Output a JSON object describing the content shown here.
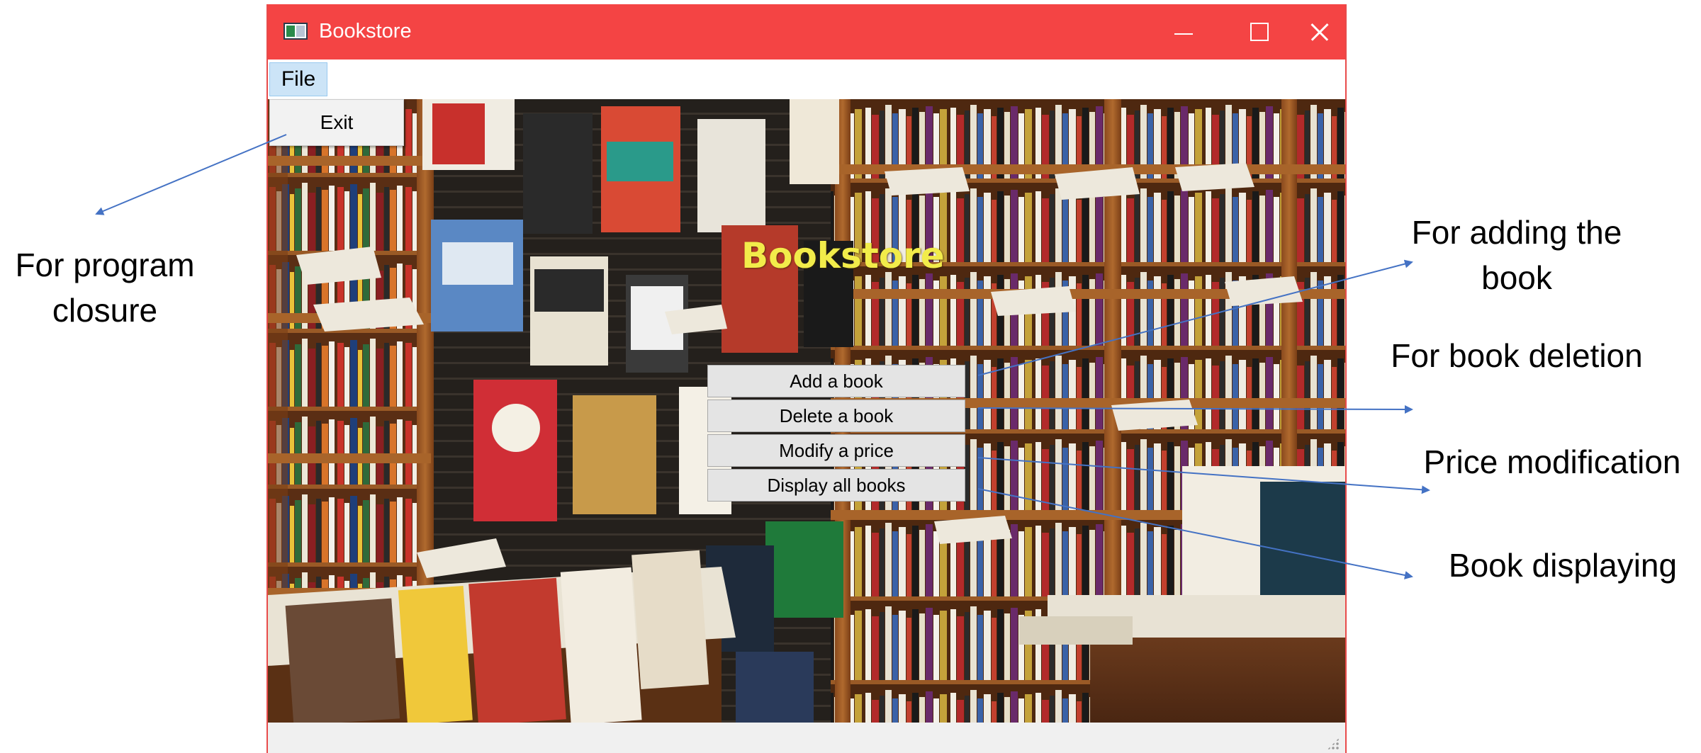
{
  "window": {
    "title": "Bookstore",
    "menu": {
      "file_label": "File",
      "exit_label": "Exit"
    },
    "heading": "Bookstore",
    "buttons": {
      "add": "Add a book",
      "delete": "Delete a book",
      "modify": "Modify a price",
      "display": "Display all books"
    },
    "colors": {
      "titlebar": "#f44444",
      "heading": "#f2ec4a",
      "arrow": "#4472c4"
    }
  },
  "annotations": {
    "close": [
      "For program",
      "closure"
    ],
    "add": [
      "For adding the",
      "book"
    ],
    "delete": "For book deletion",
    "price": "Price modification",
    "display": "Book displaying"
  }
}
